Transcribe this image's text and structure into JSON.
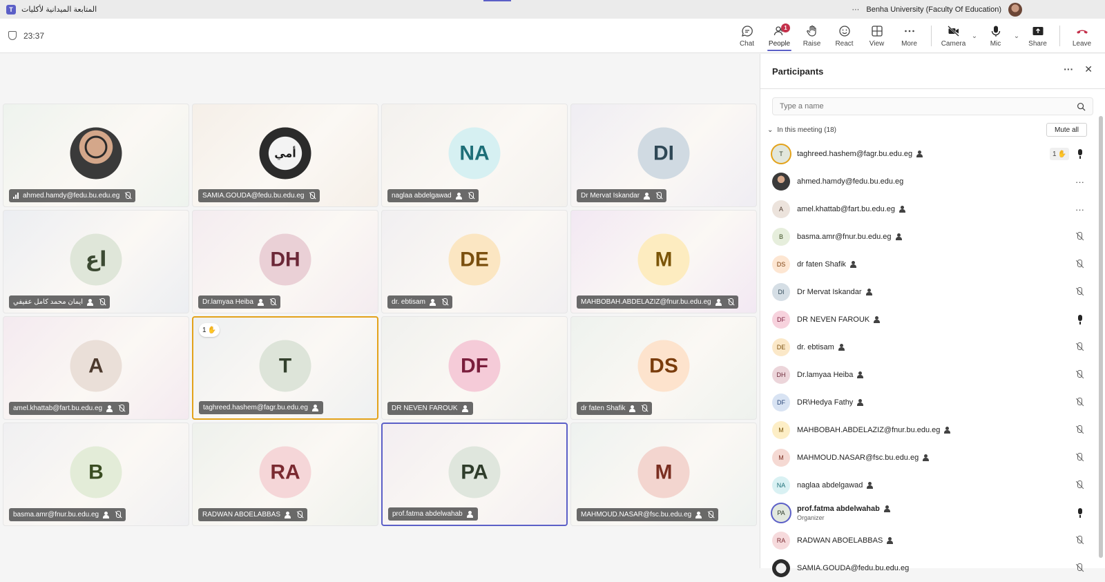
{
  "window": {
    "title": "المتابعة الميدانية لأكليات",
    "org": "Benha University (Faculty Of Education)",
    "more_glyph": "···"
  },
  "toolbar": {
    "timer": "23:37",
    "chat": "Chat",
    "people": "People",
    "people_badge": "1",
    "raise": "Raise",
    "react": "React",
    "view": "View",
    "more": "More",
    "camera": "Camera",
    "mic": "Mic",
    "share": "Share",
    "leave": "Leave"
  },
  "tiles": [
    {
      "name": "ahmed.hamdy@fedu.bu.edu.eg",
      "initials": "",
      "photo": "man",
      "bg": "#eef3ee",
      "avbg": "#fff",
      "avfg": "#333",
      "state": ""
    },
    {
      "name": "SAMIA.GOUDA@fedu.bu.edu.eg",
      "initials": "",
      "photo": "logo",
      "bg": "#f5efe8",
      "avbg": "#fff",
      "avfg": "#333",
      "state": ""
    },
    {
      "name": "naglaa abdelgawad",
      "initials": "NA",
      "bg": "#f3f1ee",
      "avbg": "#d6f0f2",
      "avfg": "#1e6f78",
      "state": ""
    },
    {
      "name": "Dr Mervat Iskandar",
      "initials": "DI",
      "bg": "#efedf3",
      "avbg": "#d0dae2",
      "avfg": "#2f4856",
      "state": ""
    },
    {
      "name": "ايمان محمد كامل عفيفي",
      "initials": "اع",
      "bg": "#eceef2",
      "avbg": "#dfe6d9",
      "avfg": "#3c4a33",
      "state": ""
    },
    {
      "name": "Dr.lamyaa Heiba",
      "initials": "DH",
      "bg": "#f4ecf0",
      "avbg": "#ead0d6",
      "avfg": "#6b2737",
      "state": ""
    },
    {
      "name": "dr. ebtisam",
      "initials": "DE",
      "bg": "#f1eff1",
      "avbg": "#fbe6c2",
      "avfg": "#7a4f0e",
      "state": ""
    },
    {
      "name": "MAHBOBAH.ABDELAZIZ@fnur.bu.edu.eg",
      "initials": "M",
      "bg": "#f2e8f3",
      "avbg": "#fdecc0",
      "avfg": "#7b5508",
      "state": ""
    },
    {
      "name": "amel.khattab@fart.bu.edu.eg",
      "initials": "A",
      "bg": "#f4eaf0",
      "avbg": "#eadfd8",
      "avfg": "#4d3a2e",
      "state": ""
    },
    {
      "name": "taghreed.hashem@fagr.bu.edu.eg",
      "initials": "T",
      "bg": "#eef0f1",
      "avbg": "#dde4d9",
      "avfg": "#33402d",
      "state": "raised",
      "hand": "1"
    },
    {
      "name": "DR NEVEN FAROUK",
      "initials": "DF",
      "bg": "#f0f1ee",
      "avbg": "#f5cbd8",
      "avfg": "#7a1e3c",
      "state": ""
    },
    {
      "name": "dr faten Shafik",
      "initials": "DS",
      "bg": "#eef2ee",
      "avbg": "#fde3cd",
      "avfg": "#7a3c0c",
      "state": ""
    },
    {
      "name": "basma.amr@fnur.bu.edu.eg",
      "initials": "B",
      "bg": "#f0f0f2",
      "avbg": "#e3ecd8",
      "avfg": "#3a4d22",
      "state": ""
    },
    {
      "name": "RADWAN ABOELABBAS",
      "initials": "RA",
      "bg": "#eef1ec",
      "avbg": "#f5d6d8",
      "avfg": "#7a2a31",
      "state": ""
    },
    {
      "name": "prof.fatma abdelwahab",
      "initials": "PA",
      "bg": "#f3eef1",
      "avbg": "#dfe6dd",
      "avfg": "#2f3d2b",
      "state": "speaking"
    },
    {
      "name": "MAHMOUD.NASAR@fsc.bu.edu.eg",
      "initials": "M",
      "bg": "#eef2f0",
      "avbg": "#f3d5cf",
      "avfg": "#7a2e21",
      "state": ""
    }
  ],
  "panel": {
    "title": "Participants",
    "more_glyph": "···",
    "close_glyph": "✕",
    "search_placeholder": "Type a name",
    "section": "In this meeting (18)",
    "mute_all": "Mute all",
    "organizer_label": "Organizer",
    "participants": [
      {
        "name": "taghreed.hashem@fagr.bu.edu.eg",
        "initials": "T",
        "avbg": "#e2e7dc",
        "avfg": "#33402d",
        "ring": "gold",
        "right": "hand-mic",
        "hand": "1"
      },
      {
        "name": "ahmed.hamdy@fedu.bu.edu.eg",
        "initials": "",
        "avbg": "#8a6a5a",
        "avfg": "#fff",
        "ring": "",
        "right": "more",
        "noperson": true
      },
      {
        "name": "amel.khattab@fart.bu.edu.eg",
        "initials": "A",
        "avbg": "#ece3dc",
        "avfg": "#4d3a2e",
        "ring": "",
        "right": "more"
      },
      {
        "name": "basma.amr@fnur.bu.edu.eg",
        "initials": "B",
        "avbg": "#e6eedc",
        "avfg": "#3a4d22",
        "ring": "",
        "right": "muted"
      },
      {
        "name": "dr faten Shafik",
        "initials": "DS",
        "avbg": "#fde6d2",
        "avfg": "#7a3c0c",
        "ring": "",
        "right": "muted"
      },
      {
        "name": "Dr Mervat Iskandar",
        "initials": "DI",
        "avbg": "#d5dee5",
        "avfg": "#2f4856",
        "ring": "",
        "right": "muted"
      },
      {
        "name": "DR NEVEN FAROUK",
        "initials": "DF",
        "avbg": "#f7d2dd",
        "avfg": "#7a1e3c",
        "ring": "",
        "right": "mic"
      },
      {
        "name": "dr. ebtisam",
        "initials": "DE",
        "avbg": "#fbe8c8",
        "avfg": "#7a4f0e",
        "ring": "",
        "right": "muted"
      },
      {
        "name": "Dr.lamyaa Heiba",
        "initials": "DH",
        "avbg": "#ecd5da",
        "avfg": "#6b2737",
        "ring": "",
        "right": "muted"
      },
      {
        "name": "DR\\Hedya Fathy",
        "initials": "DF",
        "avbg": "#d8e3f3",
        "avfg": "#2a4677",
        "ring": "",
        "right": "muted"
      },
      {
        "name": "MAHBOBAH.ABDELAZIZ@fnur.bu.edu.eg",
        "initials": "M",
        "avbg": "#fdeec6",
        "avfg": "#7b5508",
        "ring": "",
        "right": "muted"
      },
      {
        "name": "MAHMOUD.NASAR@fsc.bu.edu.eg",
        "initials": "M",
        "avbg": "#f5d9d3",
        "avfg": "#7a2e21",
        "ring": "",
        "right": "muted"
      },
      {
        "name": "naglaa abdelgawad",
        "initials": "NA",
        "avbg": "#d9f1f3",
        "avfg": "#1e6f78",
        "ring": "",
        "right": "muted"
      },
      {
        "name": "prof.fatma abdelwahab",
        "initials": "PA",
        "avbg": "#e2e8df",
        "avfg": "#2f3d2b",
        "ring": "blue",
        "right": "mic",
        "organizer": true
      },
      {
        "name": "RADWAN ABOELABBAS",
        "initials": "RA",
        "avbg": "#f6dadc",
        "avfg": "#7a2a31",
        "ring": "",
        "right": "muted"
      },
      {
        "name": "SAMIA.GOUDA@fedu.bu.edu.eg",
        "initials": "",
        "avbg": "#2d2d2d",
        "avfg": "#fff",
        "ring": "",
        "right": "muted",
        "noperson": true
      }
    ]
  }
}
